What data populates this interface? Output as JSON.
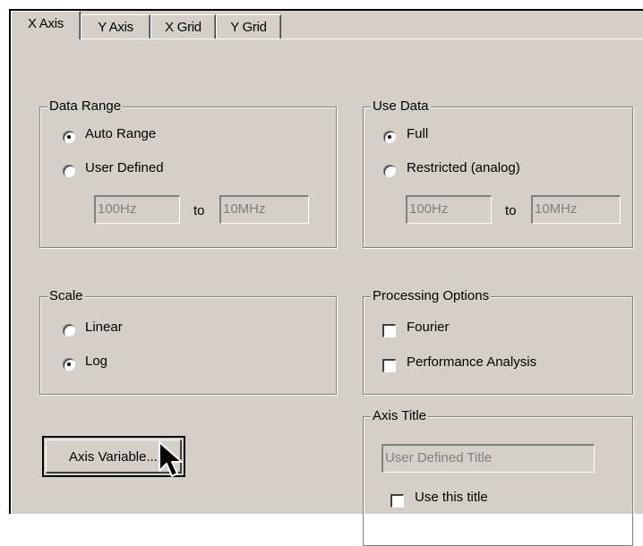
{
  "tabs": [
    {
      "label": "X Axis",
      "active": true
    },
    {
      "label": "Y Axis",
      "active": false
    },
    {
      "label": "X Grid",
      "active": false
    },
    {
      "label": "Y Grid",
      "active": false
    }
  ],
  "data_range": {
    "title": "Data Range",
    "auto_label": "Auto Range",
    "user_label": "User Defined",
    "from_value": "100Hz",
    "to_label": "to",
    "to_value": "10MHz",
    "selected": "auto"
  },
  "use_data": {
    "title": "Use Data",
    "full_label": "Full",
    "restricted_label": "Restricted (analog)",
    "from_value": "100Hz",
    "to_label": "to",
    "to_value": "10MHz",
    "selected": "full"
  },
  "scale": {
    "title": "Scale",
    "linear_label": "Linear",
    "log_label": "Log",
    "selected": "log"
  },
  "processing": {
    "title": "Processing Options",
    "fourier_label": "Fourier",
    "fourier_checked": false,
    "performance_label": "Performance Analysis",
    "performance_checked": false
  },
  "axis_title": {
    "title": "Axis Title",
    "value": "User Defined Title",
    "use_label": "Use this title",
    "use_checked": false
  },
  "axis_variable_button": "Axis Variable...",
  "colors": {
    "face": "#d4d0c8",
    "shadow": "#808080",
    "dark": "#404040",
    "highlight": "#ffffff"
  }
}
